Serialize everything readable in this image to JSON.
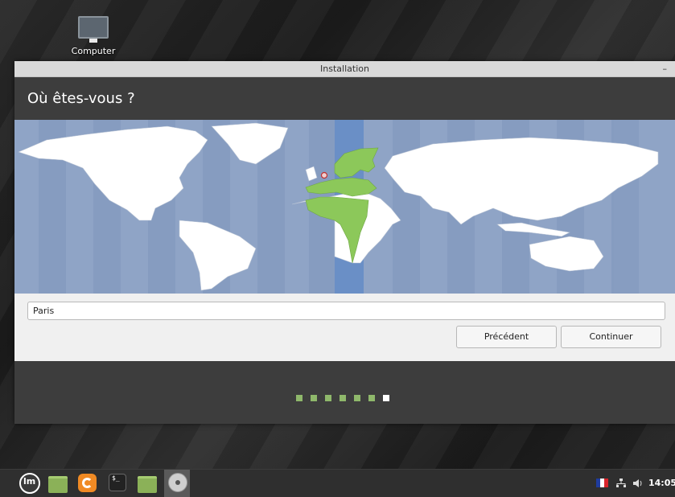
{
  "desktop": {
    "icon_label": "Computer"
  },
  "window": {
    "title": "Installation",
    "minimize_label": "–",
    "heading": "Où êtes-vous ?",
    "timezone_input_value": "Paris",
    "buttons": {
      "previous": "Précédent",
      "continue": "Continuer"
    },
    "progress": {
      "total_steps": 7,
      "current_step": 7
    },
    "colors": {
      "ocean": "#8fa4c6",
      "selected_band": "#6a8fc6",
      "selected_region": "#8cc85a",
      "header": "#3d3d3d"
    }
  },
  "taskbar": {
    "icons": [
      "menu-icon",
      "files-icon",
      "firefox-icon",
      "terminal-icon",
      "folder-icon",
      "installer-disc-icon"
    ],
    "tray_icons": [
      "french-flag-icon",
      "network-icon",
      "volume-icon"
    ],
    "clock": "14:05"
  }
}
